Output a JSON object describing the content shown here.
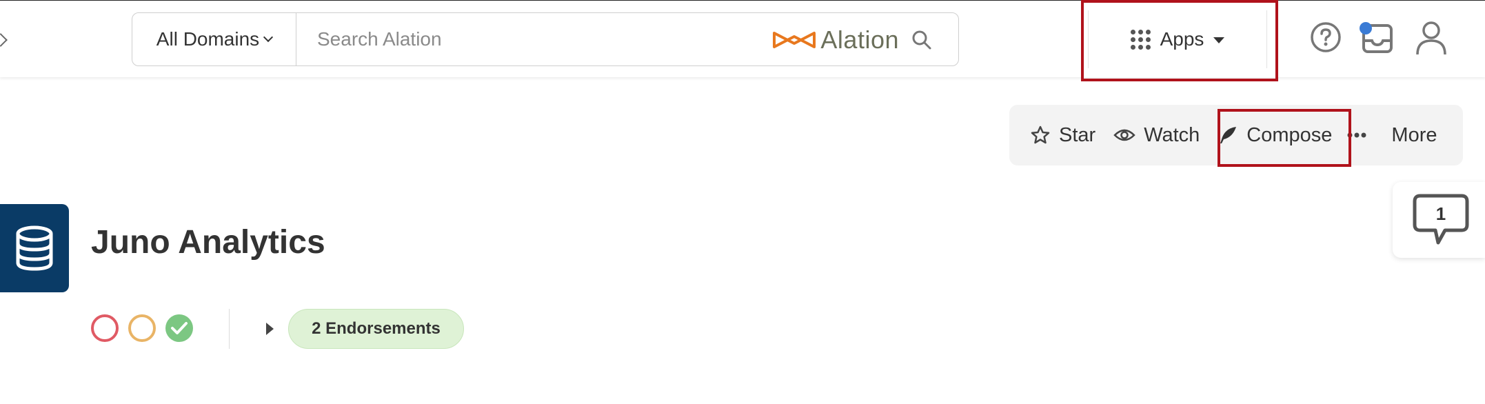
{
  "search": {
    "domain_label": "All Domains",
    "placeholder": "Search Alation",
    "brand_name": "Alation"
  },
  "nav": {
    "apps_label": "Apps",
    "icons": [
      "help-icon",
      "inbox-icon",
      "user-icon"
    ]
  },
  "toolbar": {
    "star_label": "Star",
    "watch_label": "Watch",
    "compose_label": "Compose",
    "more_label": "More"
  },
  "feedback": {
    "count": "1"
  },
  "entity": {
    "title": "Juno Analytics",
    "endorsements_label": "2 Endorsements"
  },
  "colors": {
    "brand_orange": "#e8781e",
    "db_badge": "#0a3b66",
    "highlight_red": "#b0121b",
    "status_deprecated": "#e05a64",
    "status_warning": "#e9b466",
    "status_endorsed": "#7cc782",
    "notification_dot": "#3a7bd5"
  }
}
